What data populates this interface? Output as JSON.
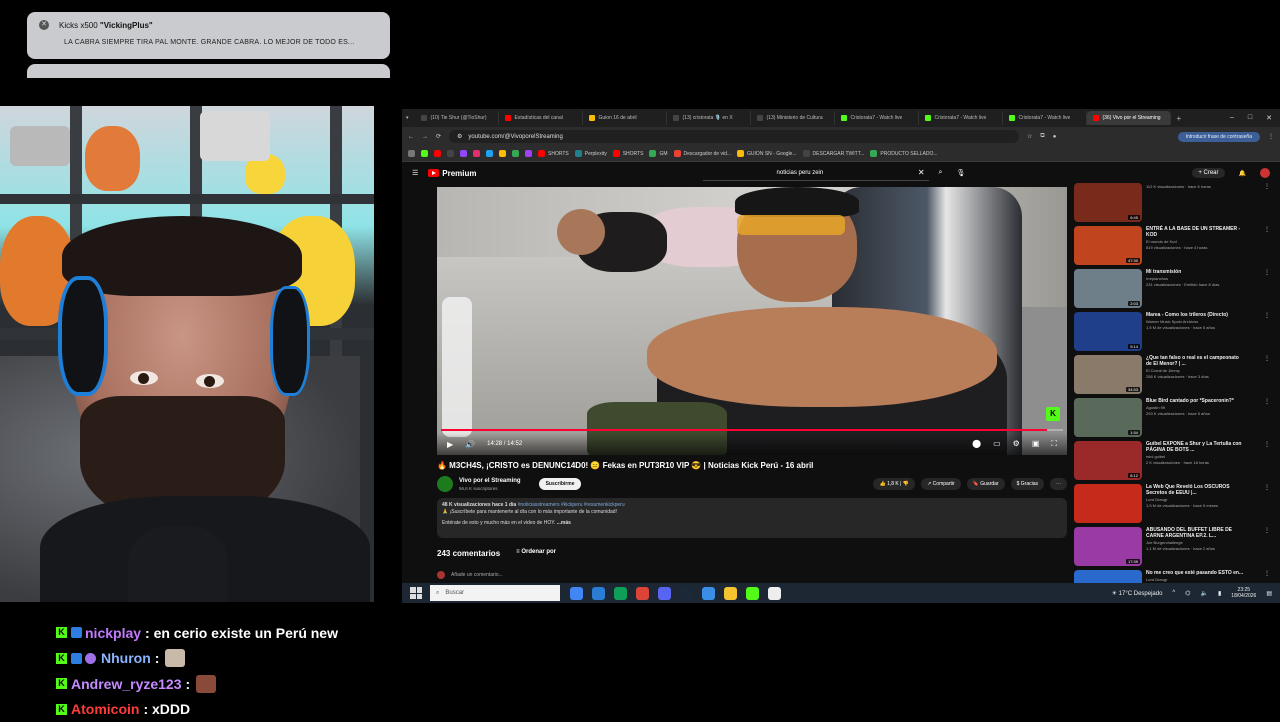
{
  "notification": {
    "title_prefix": "Kicks x500",
    "title_user": "\"VickingPlus\"",
    "message": "LA CABRA SIEMPRE TIRA PAL MONTE. GRANDE CABRA. LO MEJOR DE TODO ES..."
  },
  "chat": {
    "messages": [
      {
        "user": "nickplay",
        "color": "#c27bff",
        "text": ": en cerio existe un Perú new"
      },
      {
        "user": "Nhuron",
        "color": "#8ab4ff",
        "text": ":"
      },
      {
        "user": "Andrew_ryze123",
        "color": "#c58bff",
        "text": ":"
      },
      {
        "user": "Atomicoin",
        "color": "#ff3b3b",
        "text": ": xDDD"
      }
    ]
  },
  "browser": {
    "tabs": [
      {
        "label": "(10) Tie Shur (@TioShur)",
        "color": "#000000"
      },
      {
        "label": "Estadísticas del canal",
        "color": "#ff0000"
      },
      {
        "label": "Guion 16 de abril",
        "color": "#fbbc04"
      },
      {
        "label": "(13) cristorata 🎙️ en X",
        "color": "#000000"
      },
      {
        "label": "(13) Ministerio de Cultura",
        "color": "#000000"
      },
      {
        "label": "Cristorata7 - Watch live",
        "color": "#53fc18"
      },
      {
        "label": "Cristorata7 - Watch live",
        "color": "#53fc18"
      },
      {
        "label": "Cristorata7 - Watch live",
        "color": "#53fc18"
      },
      {
        "label": "(36) Vivo por el Streaming",
        "color": "#ff0000"
      }
    ],
    "url": "youtube.com/@VivoporelStreaming",
    "password_button": "Introducir frase de contraseña",
    "bookmarks": [
      "SHORTS",
      "Perplexity",
      "SHORTS",
      "GM",
      "Descargador de vid...",
      "GUION SN - Google...",
      "DESCARGAR TWITT...",
      "PRODUCTO SELLADO..."
    ]
  },
  "youtube": {
    "logo": "Premium",
    "search_value": "noticias peru zein",
    "create_label": "Crear",
    "time": "14:28 / 14:52",
    "progress": 0.975,
    "video_title": "🔥 M3CH4S, ¡CRISTO es DENUNC14D0! 😑 Fekas en PUT3R10 VIP 😎 | Noticias Kick Perú - 16 abril",
    "channel": "Vivo por el Streaming",
    "subscribers": "56,6 K suscriptores",
    "subscribe": "Suscribirme",
    "likes": "1,8 K",
    "share": "Compartir",
    "save": "Guardar",
    "thanks": "Gracias",
    "desc_stats": "48 K visualizaciones  hace 1 día",
    "desc_tags": "#noticiasstreamers #kickperu #resumenkickperu",
    "desc_line1": "🙏 ¡Suscríbete para mantenerte al día con lo más importante de la comunidad!",
    "desc_line2": "Entérate de esto y mucho más en el video de HOY.",
    "desc_more": "...más",
    "comments_count": "243 comentarios",
    "sort_label": "Ordenar por",
    "add_comment": "Añade un comentario...",
    "related": [
      {
        "title": "",
        "channel": "",
        "meta": "112 K visualizaciones · hace 6 horas",
        "dur": "6:45",
        "color": "#7a2a1a"
      },
      {
        "title": "ENTRÉ A LA BASE DE UN STREAMER - KOD",
        "channel": "El mundo de Kod",
        "meta": "819 visualizaciones · hace 4 horas",
        "dur": "47:30",
        "color": "#c0451e"
      },
      {
        "title": "Mi transmisión",
        "channel": "Irreplanchos",
        "meta": "231 visualizaciones · Emitido hace 8 días",
        "dur": "2:03",
        "color": "#6f7f8a"
      },
      {
        "title": "Marea - Como los trileros (Directo)",
        "channel": "Warner Music Spain Archivos",
        "meta": "1,5 M de visualizaciones · hace 5 años",
        "dur": "5:14",
        "color": "#1f3f8a"
      },
      {
        "title": "¿Que tan falso o real es el campeonato de El Menor? | ...",
        "channel": "El Corral de Jimmy",
        "meta": "256 K visualizaciones · hace 3 días",
        "dur": "34:53",
        "color": "#8a7a6a"
      },
      {
        "title": "Blue Bird cantado por *Spaceronin?*",
        "channel": "Agustín 99",
        "meta": "293 K visualizaciones · hace 5 años",
        "dur": "1:54",
        "color": "#5a6a5a"
      },
      {
        "title": "Guibel EXPONE a Shur y La Tertulia con PÁGINA DE BOTS ...",
        "channel": "mini guibel",
        "meta": "2 K visualizaciones · hace 18 horas",
        "dur": "8:12",
        "color": "#9a2a2a"
      },
      {
        "title": "La Web Que Reveló Los OSCUROS Secretos de EEUU |...",
        "channel": "Lord Draugr",
        "meta": "1,5 M de visualizaciones · hace 9 meses",
        "dur": "",
        "color": "#c52a1a"
      },
      {
        "title": "ABUSANDO DEL BUFFET LIBRE DE CARNE ARGENTINA EP.2. L...",
        "channel": "Joe Burgerchallenge",
        "meta": "1,1 M de visualizaciones · hace 2 años",
        "dur": "17:39",
        "color": "#9a3aa5"
      },
      {
        "title": "No me creo que esté pasando ESTO en...",
        "channel": "Lord Draugr",
        "meta": "1,2 M de visualizaciones · hace 3 meses",
        "dur": "",
        "color": "#2a6acd"
      }
    ]
  },
  "taskbar": {
    "search_placeholder": "Buscar",
    "weather": "17°C  Despejado",
    "time": "23:25",
    "date": "18/04/2026"
  }
}
